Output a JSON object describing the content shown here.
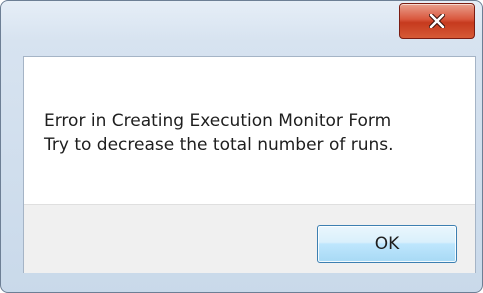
{
  "dialog": {
    "message_lines": [
      "Error in Creating Execution Monitor Form",
      "Try to decrease the total number of runs."
    ],
    "ok_label": "OK",
    "close_icon": "close-icon",
    "colors": {
      "close_button": "#c63a1e",
      "ok_button_border": "#3c7fb1",
      "footer_background": "#f0f0f0"
    }
  }
}
